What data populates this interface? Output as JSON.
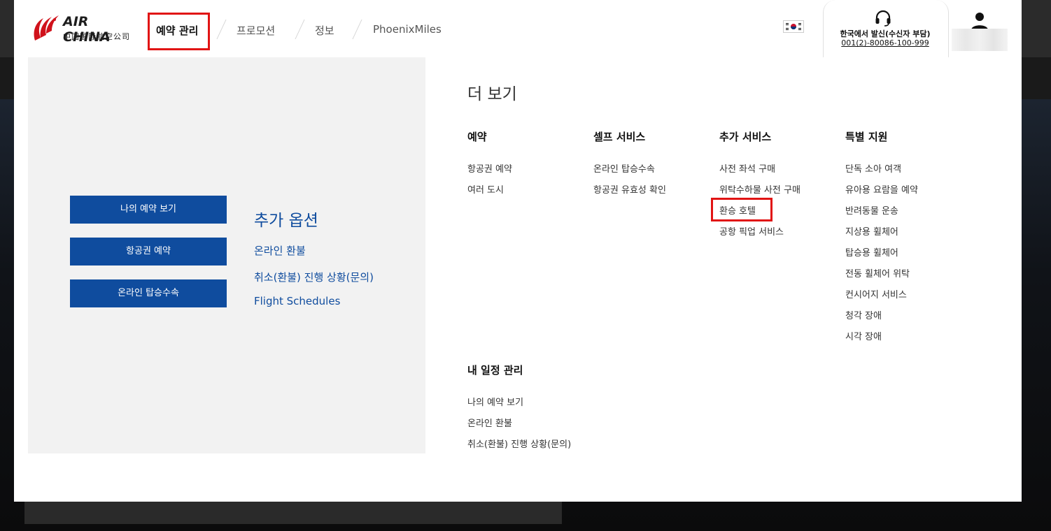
{
  "header": {
    "logo_text": "AIR CHINA",
    "logo_sub": "中国国际航空公司",
    "nav": [
      "예약 관리",
      "프로모션",
      "정보",
      "PhoenixMiles"
    ],
    "contact_label": "한국에서 발신(수신자 부담)",
    "contact_phone": "001(2)-80086-100-999",
    "flag_icon": "korea-flag-icon",
    "headset_icon": "headset-icon",
    "user_icon": "user-icon"
  },
  "left": {
    "buttons": [
      "나의 예약 보기",
      "항공권 예약",
      "온라인 탑승수속"
    ],
    "extra_title": "추가 옵션",
    "extra_links": [
      "온라인 환불",
      "취소(환불) 진행 상황(문의)",
      "Flight Schedules"
    ]
  },
  "more": {
    "title": "더 보기",
    "columns": [
      {
        "heading": "예약",
        "links": [
          "항공권 예약",
          "여러 도시"
        ]
      },
      {
        "heading": "셀프 서비스",
        "links": [
          "온라인 탑승수속",
          "항공권 유효성 확인"
        ]
      },
      {
        "heading": "추가 서비스",
        "links": [
          "사전 좌석 구매",
          "위탁수하물 사전 구매",
          "환승 호텔",
          "공항 픽업 서비스"
        ]
      },
      {
        "heading": "특별 지원",
        "links": [
          "단독 소아 여객",
          "유아용 요람을 예약",
          "반려동물 운송",
          "지상용 휠체어",
          "탑승용 휠체어",
          "전동 휠체어 위탁",
          "컨시어지 서비스",
          "청각 장애",
          "시각 장애"
        ]
      }
    ],
    "itinerary": {
      "heading": "내 일정 관리",
      "links": [
        "나의 예약 보기",
        "온라인 환불",
        "취소(환불) 진행 상황(문의)"
      ]
    }
  },
  "colors": {
    "accent_blue": "#0f4c9e",
    "highlight_red": "#e11414",
    "logo_red": "#d0121b"
  }
}
